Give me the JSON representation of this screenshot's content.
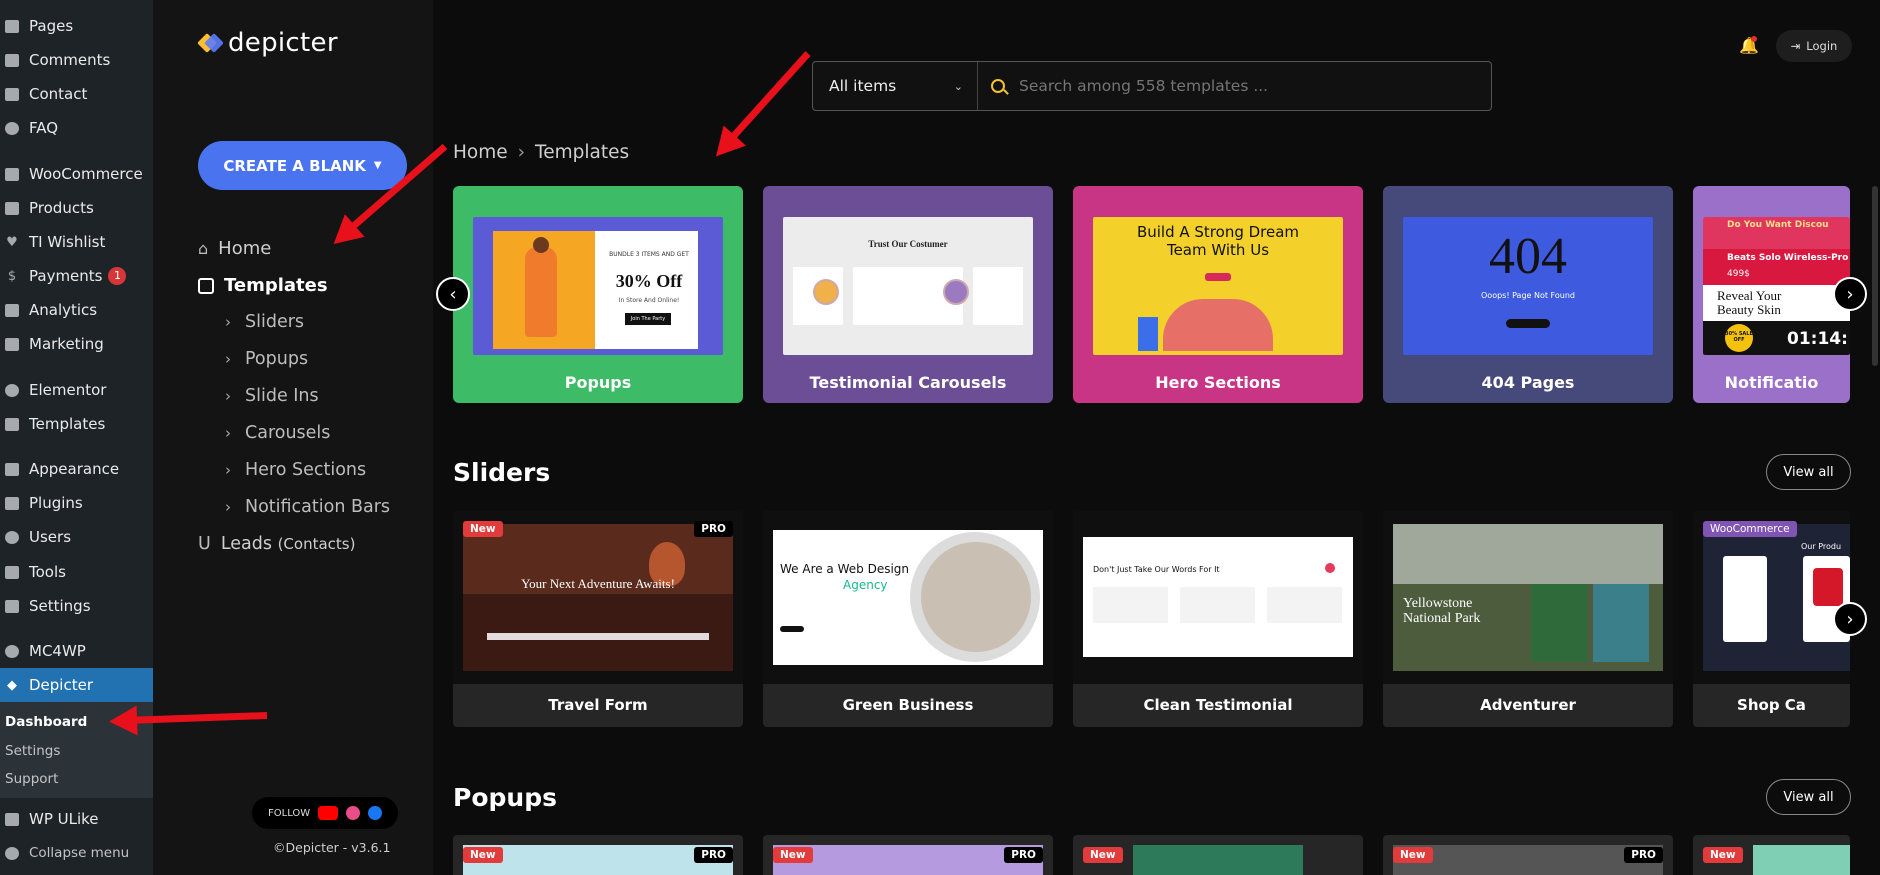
{
  "wp_menu": {
    "items": [
      {
        "label": "Pages",
        "icon": "pages-icon"
      },
      {
        "label": "Comments",
        "icon": "comments-icon"
      },
      {
        "label": "Contact",
        "icon": "mail-icon"
      },
      {
        "label": "FAQ",
        "icon": "help-icon"
      },
      {
        "label": "WooCommerce",
        "icon": "woo-icon"
      },
      {
        "label": "Products",
        "icon": "box-icon"
      },
      {
        "label": "TI Wishlist",
        "icon": "heart-icon"
      },
      {
        "label": "Payments",
        "icon": "dollar-icon",
        "badge": "1"
      },
      {
        "label": "Analytics",
        "icon": "chart-icon"
      },
      {
        "label": "Marketing",
        "icon": "megaphone-icon"
      },
      {
        "label": "Elementor",
        "icon": "elementor-icon"
      },
      {
        "label": "Templates",
        "icon": "folder-icon"
      },
      {
        "label": "Appearance",
        "icon": "brush-icon"
      },
      {
        "label": "Plugins",
        "icon": "plug-icon"
      },
      {
        "label": "Users",
        "icon": "user-icon"
      },
      {
        "label": "Tools",
        "icon": "wrench-icon"
      },
      {
        "label": "Settings",
        "icon": "sliders-icon"
      },
      {
        "label": "MC4WP",
        "icon": "mc4wp-icon"
      },
      {
        "label": "Depicter",
        "icon": "depicter-icon"
      },
      {
        "label": "WP ULike",
        "icon": "ulike-icon"
      },
      {
        "label": "Collapse menu",
        "icon": "collapse-icon"
      }
    ],
    "submenu": [
      "Dashboard",
      "Settings",
      "Support"
    ]
  },
  "app": {
    "logo": "depicter",
    "create_blank": "CREATE A BLANK",
    "nav": {
      "home": "Home",
      "templates": "Templates",
      "sub": [
        "Sliders",
        "Popups",
        "Slide Ins",
        "Carousels",
        "Hero Sections",
        "Notification Bars"
      ],
      "leads": "Leads",
      "leads_note": "(Contacts)"
    },
    "follow": "FOLLOW",
    "copyright": "©Depicter - v3.6.1"
  },
  "search": {
    "category": "All items",
    "placeholder": "Search among 558 templates ..."
  },
  "header": {
    "login": "Login"
  },
  "breadcrumb": {
    "home": "Home",
    "sep": "›",
    "current": "Templates"
  },
  "categories": [
    {
      "label": "Popups",
      "color": "#3dbb67"
    },
    {
      "label": "Testimonial Carousels",
      "color": "#6b4e96"
    },
    {
      "label": "Hero Sections",
      "color": "#c93585"
    },
    {
      "label": "404 Pages",
      "color": "#454a7a"
    },
    {
      "label": "Notificatio",
      "color": "#9b70c9"
    }
  ],
  "thumbs": {
    "popup_offer": "30% Off",
    "popup_bundle": "BUNDLE 3 ITEMS AND GET",
    "popup_instore": "In Store And Online!",
    "popup_cta": "Join The Party",
    "testimonial_title": "Trust Our Costumer",
    "hero_title": "Build A Strong Dream Team With Us",
    "e404_code": "404",
    "e404_msg": "Ooops! Page Not Found",
    "notif_top": "Do You Want Discou",
    "notif_beats": "Beats Solo Wireless-Pro",
    "notif_price": "499$",
    "notif_reveal": "Reveal Your Beauty Skin",
    "notif_sale": "30% SALE OFF",
    "notif_timer": "01:14:"
  },
  "sections": [
    {
      "title": "Sliders",
      "view_all": "View all"
    },
    {
      "title": "Popups",
      "view_all": "View all"
    }
  ],
  "sliders": [
    {
      "name": "Travel Form",
      "new": "New",
      "pro": "PRO",
      "headline": "Your Next Adventure Awaits!"
    },
    {
      "name": "Green Business",
      "headline": "We Are a Web Design",
      "accent": "Agency"
    },
    {
      "name": "Clean Testimonial",
      "headline": "Don't Just Take Our Words For It"
    },
    {
      "name": "Adventurer",
      "headline": "Yellowstone National Park"
    },
    {
      "name": "Shop Ca",
      "tag": "WooCommerce",
      "headline": "Our Produ"
    }
  ],
  "popup_tags": {
    "new": "New",
    "pro": "PRO"
  }
}
